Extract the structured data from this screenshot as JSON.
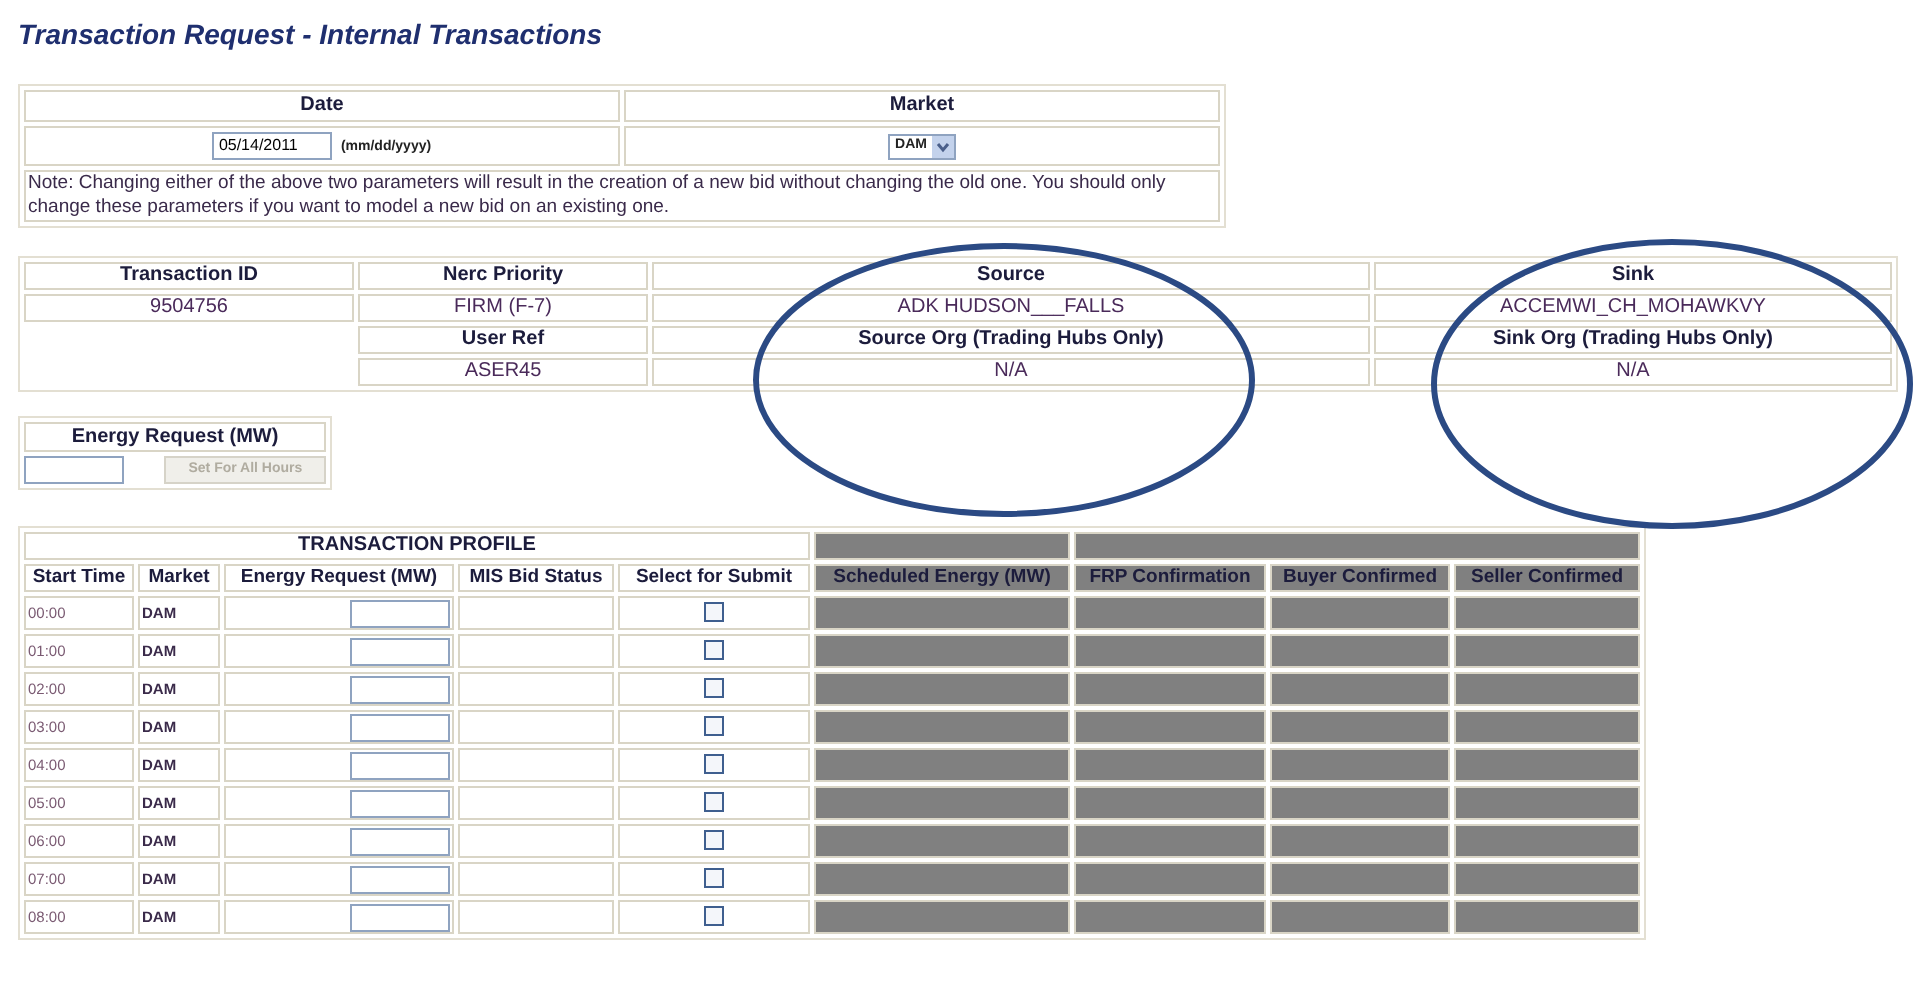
{
  "page_title": "Transaction Request - Internal Transactions",
  "bid_params": {
    "date_label": "Date",
    "market_label": "Market",
    "date_value": "05/14/2011",
    "date_format": "(mm/dd/yyyy)",
    "market_value": "DAM",
    "note": "Note:  Changing either of the above two parameters will result in the creation of a new bid without changing the old one. You should only change these parameters if you want to model a new bid on an existing one."
  },
  "transaction": {
    "headers": [
      "Transaction ID",
      "Nerc Priority",
      "Source",
      "Sink"
    ],
    "values": [
      "9504756",
      "FIRM (F-7)",
      "ADK HUDSON___FALLS",
      "ACCEMWI_CH_MOHAWKVY"
    ],
    "headers2": [
      "User Ref",
      "Source Org (Trading Hubs Only)",
      "Sink Org (Trading Hubs Only)"
    ],
    "values2": [
      "ASER45",
      "N/A",
      "N/A"
    ]
  },
  "highlights": [
    {
      "kind": "ellipse"
    },
    {
      "kind": "ellipse"
    }
  ],
  "energy_request": {
    "label": "Energy Request (MW)",
    "button": "Set For All Hours",
    "button_disabled": true
  },
  "profile": {
    "title": "TRANSACTION PROFILE",
    "columns": [
      {
        "label": "Start Time",
        "shaded": false
      },
      {
        "label": "Market",
        "shaded": false
      },
      {
        "label": "Energy Request (MW)",
        "shaded": false
      },
      {
        "label": "MIS Bid Status",
        "shaded": false
      },
      {
        "label": "Select for Submit",
        "shaded": false
      },
      {
        "label": "Scheduled Energy (MW)",
        "shaded": true
      },
      {
        "label": "FRP Confirmation",
        "shaded": true
      },
      {
        "label": "Buyer Confirmed",
        "shaded": true
      },
      {
        "label": "Seller Confirmed",
        "shaded": true
      }
    ],
    "rows": [
      {
        "start_time": "00:00",
        "market": "DAM",
        "checked": false
      },
      {
        "start_time": "01:00",
        "market": "DAM",
        "checked": false
      },
      {
        "start_time": "02:00",
        "market": "DAM",
        "checked": false
      },
      {
        "start_time": "03:00",
        "market": "DAM",
        "checked": false
      },
      {
        "start_time": "04:00",
        "market": "DAM",
        "checked": false
      },
      {
        "start_time": "05:00",
        "market": "DAM",
        "checked": false
      },
      {
        "start_time": "06:00",
        "market": "DAM",
        "checked": false
      },
      {
        "start_time": "07:00",
        "market": "DAM",
        "checked": false
      },
      {
        "start_time": "08:00",
        "market": "DAM",
        "checked": false
      }
    ]
  }
}
